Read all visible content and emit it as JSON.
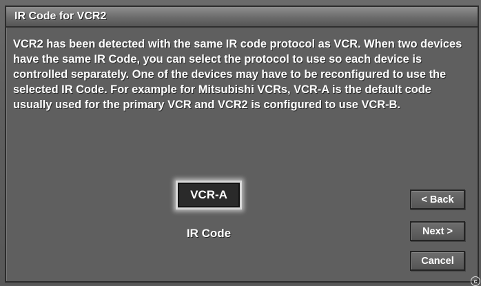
{
  "dialog": {
    "title": "IR Code for VCR2",
    "message": "VCR2 has been detected with the same IR code protocol as VCR. When two devices have the same IR Code, you can select the protocol to use so each device is controlled separately. One of the devices may have to be reconfigured to use the selected IR Code.  For example for Mitsubishi VCRs, VCR-A is the default code usually used for the primary VCR and VCR2 is configured to use VCR-B."
  },
  "ir_code": {
    "selected_value": "VCR-A",
    "label": "IR Code"
  },
  "buttons": {
    "back": "< Back",
    "next": "Next >",
    "cancel": "Cancel"
  },
  "footer": {
    "copyright_symbol": "c"
  },
  "colors": {
    "background": "#5f5f5f",
    "text": "#ffffff",
    "selected_button_fill": "#2a2a2a"
  }
}
